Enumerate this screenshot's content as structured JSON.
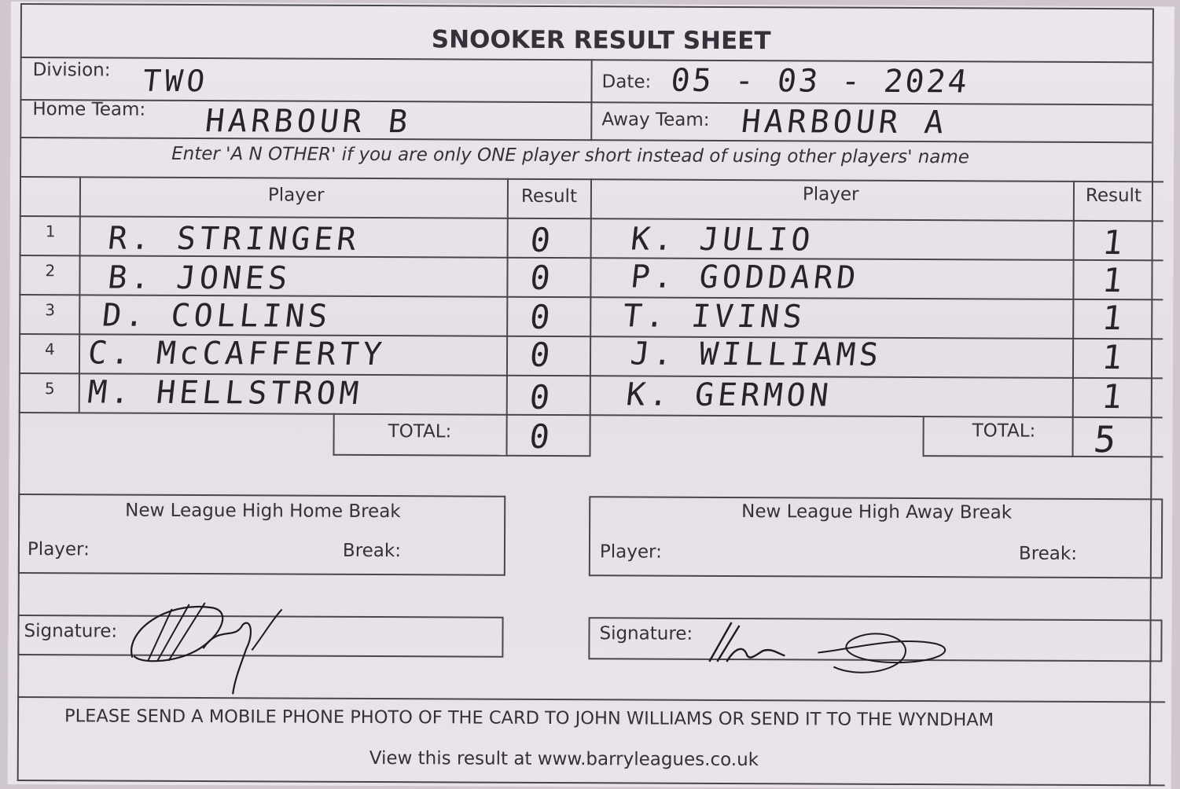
{
  "title": "SNOOKER RESULT SHEET",
  "division": {
    "label": "Division:",
    "value": "TWO"
  },
  "date": {
    "label": "Date:",
    "value": "05 - 03 - 2024"
  },
  "home_team": {
    "label": "Home Team:",
    "value": "HARBOUR B"
  },
  "away_team": {
    "label": "Away Team:",
    "value": "HARBOUR A"
  },
  "instruction": "Enter 'A N OTHER' if you are only ONE player short instead of using other players' name",
  "columns": {
    "player": "Player",
    "result": "Result"
  },
  "rows": [
    {
      "num": "1",
      "home_player": "R. STRINGER",
      "home_result": "0",
      "away_player": "K. JULIO",
      "away_result": "1"
    },
    {
      "num": "2",
      "home_player": "B. JONES",
      "home_result": "0",
      "away_player": "P. GODDARD",
      "away_result": "1"
    },
    {
      "num": "3",
      "home_player": "D. COLLINS",
      "home_result": "0",
      "away_player": "T. IVINS",
      "away_result": "1"
    },
    {
      "num": "4",
      "home_player": "C. McCAFFERTY",
      "home_result": "0",
      "away_player": "J. WILLIAMS",
      "away_result": "1"
    },
    {
      "num": "5",
      "home_player": "M. HELLSTROM",
      "home_result": "0",
      "away_player": "K. GERMON",
      "away_result": "1"
    }
  ],
  "totals": {
    "label": "TOTAL:",
    "home": "0",
    "away": "5"
  },
  "home_break": {
    "heading": "New League High Home Break",
    "player_label": "Player:",
    "break_label": "Break:"
  },
  "away_break": {
    "heading": "New League High Away Break",
    "player_label": "Player:",
    "break_label": "Break:"
  },
  "signature_label": "Signature:",
  "footer": {
    "line1": "PLEASE SEND A MOBILE PHONE PHOTO OF THE CARD TO JOHN WILLIAMS OR SEND IT TO THE WYNDHAM",
    "line2": "View this result at www.barryleagues.co.uk"
  },
  "colors": {
    "paper": "#e9e4ea",
    "ink": "#26232b",
    "print": "#35313a"
  }
}
